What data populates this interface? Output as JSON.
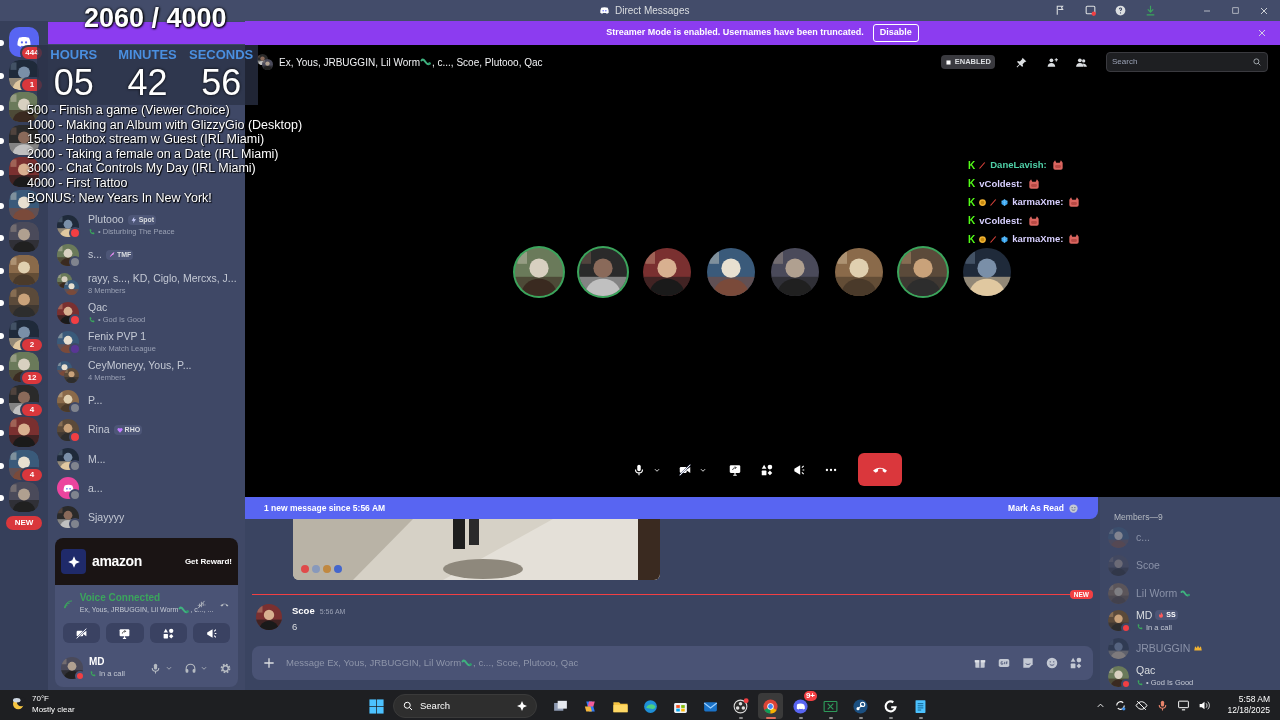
{
  "title_bar": {
    "title": "Direct Messages",
    "inbox_alert": true
  },
  "stream_overlay": {
    "goal": "2060 / 4000",
    "timer": [
      {
        "label": "HOURS",
        "value": "05"
      },
      {
        "label": "MINUTES",
        "value": "42"
      },
      {
        "label": "SECONDS",
        "value": "56"
      }
    ],
    "goals": [
      "500 - Finish a game (Viewer Choice)",
      "1000 - Making an Album with GlizzyGio (Desktop)",
      "1500 - Hotbox stream w Guest (IRL Miami)",
      "2000 - Taking a female on a Date (IRL Miami)",
      "3000 - Chat Controls My Day (IRL Miami)",
      "4000 - First Tattoo",
      "BONUS: New Years In New York!"
    ]
  },
  "servers": [
    {
      "kind": "discord",
      "badge": "444",
      "unread": true
    },
    {
      "kind": "server",
      "badge": "1",
      "unread": true
    },
    {
      "kind": "server",
      "unread": true
    },
    {
      "kind": "server",
      "unread": true
    },
    {
      "kind": "server",
      "unread": true
    },
    {
      "kind": "server",
      "unread": true
    },
    {
      "kind": "server",
      "unread": true
    },
    {
      "kind": "server",
      "unread": true
    },
    {
      "kind": "server",
      "unread": true
    },
    {
      "kind": "server",
      "badge": "2",
      "unread": true
    },
    {
      "kind": "server",
      "badge": "12",
      "unread": true
    },
    {
      "kind": "server",
      "badge": "4",
      "unread": true
    },
    {
      "kind": "server",
      "unread": true
    },
    {
      "kind": "server",
      "badge": "4",
      "unread": true
    },
    {
      "kind": "server",
      "unread": true
    }
  ],
  "new_pill": "NEW",
  "dms": [
    {
      "kind": "dm",
      "name": "Plutooo",
      "tag": "Spot",
      "subtitle": "• Disturbing The Peace",
      "in_call": true,
      "color": "#f23f43"
    },
    {
      "kind": "dm",
      "name": "s...",
      "tag": "TMF",
      "in_call": false,
      "color": "#80848e"
    },
    {
      "kind": "group",
      "name": "rayy, s..., KD, Ciglo, Mercxs, J...",
      "subtitle": "8 Members",
      "in_call": false
    },
    {
      "kind": "dm",
      "name": "Qac",
      "subtitle": "• God Is Good",
      "in_call": true,
      "color": "#f23f43"
    },
    {
      "kind": "dm",
      "name": "Fenix PVP 1",
      "subtitle": "Fenix Match League",
      "in_call": false,
      "color": "#593695"
    },
    {
      "kind": "group",
      "name": "CeyMoneyy, Yous, P...",
      "subtitle": "4 Members",
      "in_call": false
    },
    {
      "kind": "dm",
      "name": "P...",
      "in_call": false,
      "color": "#80848e"
    },
    {
      "kind": "dm",
      "name": "Rina",
      "tag": "RHO",
      "in_call": false,
      "color": "#f23f43"
    },
    {
      "kind": "dm",
      "name": "M...",
      "in_call": false,
      "color": "#80848e"
    },
    {
      "kind": "default",
      "name": "a...",
      "in_call": false,
      "color": "#80848e"
    },
    {
      "kind": "dm",
      "name": "Sjayyyy",
      "in_call": false,
      "color": "#80848e"
    }
  ],
  "promo": {
    "brand": "amazon",
    "button": "Get Reward!"
  },
  "voice": {
    "status": "Voice Connected",
    "channel_parts": [
      "Ex, Yous, JRBUGGIN, Lil Worm",
      ", c..., ..."
    ]
  },
  "user": {
    "name": "MD",
    "status": "In a call"
  },
  "banner": {
    "text": "Streamer Mode is enabled. Usernames have been truncated.",
    "button": "Disable"
  },
  "call": {
    "title_parts": [
      "Ex, Yous, JRBUGGIN, Lil Worm",
      ", c..., Scoe, Plutooo, Qac"
    ],
    "streamer_mode": "ENABLED",
    "search_placeholder": "Search",
    "participants": [
      {
        "speaking": true
      },
      {
        "speaking": true
      },
      {
        "speaking": false
      },
      {
        "speaking": false
      },
      {
        "speaking": false
      },
      {
        "speaking": false
      },
      {
        "speaking": true
      },
      {
        "speaking": false
      }
    ],
    "stream_chat": [
      {
        "badge": "K",
        "kind": "moderator",
        "user": "DaneLavish:",
        "color": "#4fd1a8"
      },
      {
        "badge": "K",
        "kind": "viewer",
        "user": "vColdest:",
        "color": "#d8d0ff"
      },
      {
        "badge": "K",
        "kind": "supporter",
        "user": "karmaXme:",
        "color": "#d8d0ff"
      },
      {
        "badge": "K",
        "kind": "viewer",
        "user": "vColdest:",
        "color": "#d8d0ff"
      },
      {
        "badge": "K",
        "kind": "supporter",
        "user": "karmaXme:",
        "color": "#d8d0ff"
      }
    ]
  },
  "chat": {
    "new_bar": "1 new message since 5:56 AM",
    "mark_read": "Mark As Read",
    "divider": "NEW",
    "messages": [
      {
        "author": "Scoe",
        "time": "5:56 AM",
        "text": "6"
      }
    ],
    "input_parts": [
      "Message Ex, Yous, JRBUGGIN, Lil Worm",
      ", c..., Scoe, Plutooo, Qac"
    ]
  },
  "members": {
    "header": "Members—9",
    "list": [
      {
        "name": "c...",
        "offline": true,
        "kind": "plain"
      },
      {
        "name": "Scoe",
        "offline": true,
        "kind": "plain"
      },
      {
        "name": "Lil Worm",
        "offline": true,
        "kind": "worm"
      },
      {
        "name": "MD",
        "offline": false,
        "kind": "plain",
        "tag": "SS",
        "subtitle": "In a call"
      },
      {
        "name": "JRBUGGIN",
        "offline": true,
        "kind": "owner"
      },
      {
        "name": "Qac",
        "offline": false,
        "kind": "plain",
        "subtitle": "• God Is Good"
      }
    ]
  },
  "taskbar": {
    "weather": {
      "temp": "70°F",
      "condition": "Mostly clear"
    },
    "search": "Search",
    "apps": [
      {
        "kind": "taskview",
        "running": false,
        "selected": false
      },
      {
        "kind": "copilot",
        "running": false,
        "selected": false
      },
      {
        "kind": "folder",
        "running": false,
        "selected": false
      },
      {
        "kind": "edge",
        "running": false,
        "selected": false
      },
      {
        "kind": "store",
        "running": false,
        "selected": false
      },
      {
        "kind": "mail",
        "running": false,
        "selected": false
      },
      {
        "kind": "obs",
        "running": true,
        "selected": false
      },
      {
        "kind": "chrome",
        "running": true,
        "selected": true
      },
      {
        "kind": "discord",
        "running": true,
        "selected": false,
        "badge": "9+"
      },
      {
        "kind": "sheet",
        "running": true,
        "selected": false
      },
      {
        "kind": "steam",
        "running": true,
        "selected": false
      },
      {
        "kind": "logi",
        "running": true,
        "selected": false
      },
      {
        "kind": "notepad",
        "running": true,
        "selected": false
      }
    ],
    "time": "5:58 AM",
    "date": "12/18/2025"
  }
}
